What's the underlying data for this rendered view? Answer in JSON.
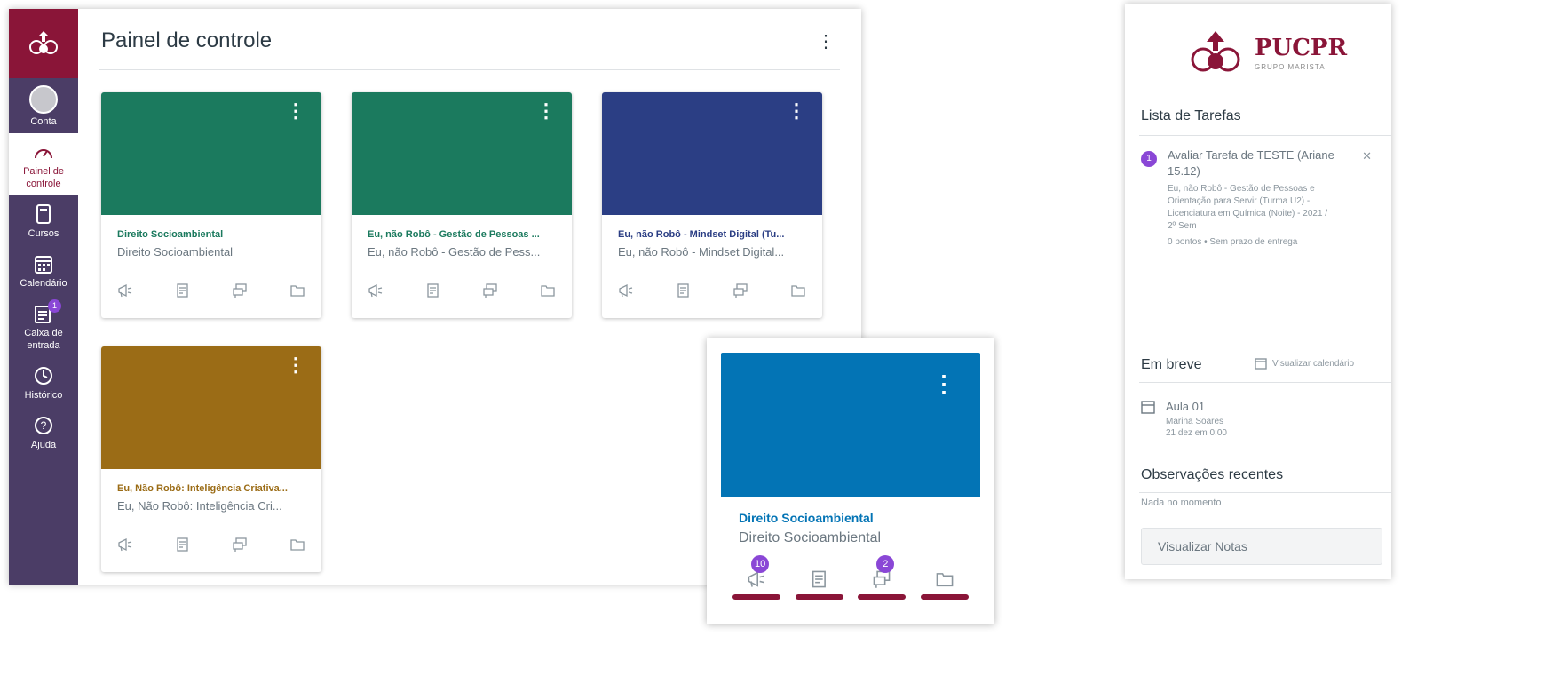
{
  "nav": {
    "account": "Conta",
    "dashboard": "Painel de controle",
    "courses": "Cursos",
    "calendar": "Calendário",
    "inbox": "Caixa de entrada",
    "inbox_badge": "1",
    "history": "Histórico",
    "help": "Ajuda"
  },
  "dashboard": {
    "title": "Painel de controle",
    "menu": "⋮"
  },
  "cards": [
    {
      "title": "Direito Socioambiental",
      "subtitle": "Direito Socioambiental",
      "color": "#1b7a5e",
      "title_color": "#1b7a5e"
    },
    {
      "title": "Eu, não Robô - Gestão de Pessoas ...",
      "subtitle": "Eu, não Robô - Gestão de Pess...",
      "color": "#1b7a5e",
      "title_color": "#1b7a5e"
    },
    {
      "title": "Eu, não Robô - Mindset Digital (Tu...",
      "subtitle": "Eu, não Robô - Mindset Digital...",
      "color": "#2b3e84",
      "title_color": "#2b3e84"
    },
    {
      "title": "Eu, Não Robô: Inteligência Criativa...",
      "subtitle": "Eu, Não Robô: Inteligência Cri...",
      "color": "#9b6c16",
      "title_color": "#9b6c16"
    }
  ],
  "zoom_card": {
    "title": "Direito Socioambiental",
    "subtitle": "Direito Socioambiental",
    "announcements_badge": "10",
    "discussions_badge": "2",
    "color": "#0374b5"
  },
  "sidebar": {
    "brand_name": "PUCPR",
    "brand_sub": "GRUPO MARISTA",
    "todo_heading": "Lista de Tarefas",
    "todo_item": {
      "count": "1",
      "title": "Avaliar Tarefa de TESTE (Ariane 15.12)",
      "course": "Eu, não Robô - Gestão de Pessoas e Orientação para Servir (Turma U2) - Licenciatura em Química (Noite) - 2021 / 2º Sem",
      "meta": "0 pontos • Sem prazo de entrega"
    },
    "upcoming_heading": "Em breve",
    "view_calendar": "Visualizar calendário",
    "upcoming_item": {
      "title": "Aula 01",
      "teacher": "Marina Soares",
      "date": "21 dez em 0:00"
    },
    "feedback_heading": "Observações recentes",
    "feedback_empty": "Nada no momento",
    "grades_button": "Visualizar Notas"
  },
  "colors": {
    "brand": "#8a1538",
    "nav_bg": "#4b3d66",
    "badge": "#8a47d6"
  }
}
